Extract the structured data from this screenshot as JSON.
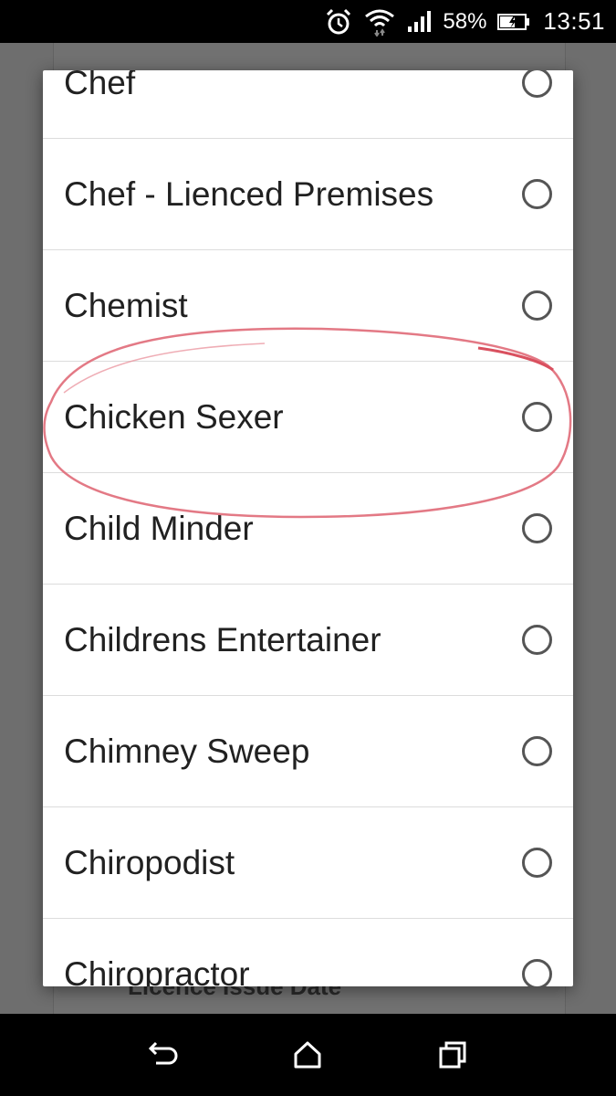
{
  "status_bar": {
    "battery_percent": "58%",
    "time": "13:51",
    "icons": [
      "alarm-clock-icon",
      "wifi-icon",
      "signal-icon",
      "battery-charging-icon"
    ]
  },
  "background": {
    "partial_label": "Licence Issue Date"
  },
  "dialog": {
    "options": [
      {
        "label": "Chef",
        "selected": false
      },
      {
        "label": "Chef - Lienced Premises",
        "selected": false
      },
      {
        "label": "Chemist",
        "selected": false
      },
      {
        "label": "Chicken Sexer",
        "selected": false
      },
      {
        "label": "Child Minder",
        "selected": false
      },
      {
        "label": "Childrens Entertainer",
        "selected": false
      },
      {
        "label": "Chimney Sweep",
        "selected": false
      },
      {
        "label": "Chiropodist",
        "selected": false
      },
      {
        "label": "Chiropractor",
        "selected": false
      }
    ]
  },
  "annotation": {
    "color": "#e06a78",
    "target": "Chicken Sexer"
  },
  "nav_bar": {
    "icons": [
      "back-icon",
      "home-icon",
      "recents-icon"
    ]
  }
}
